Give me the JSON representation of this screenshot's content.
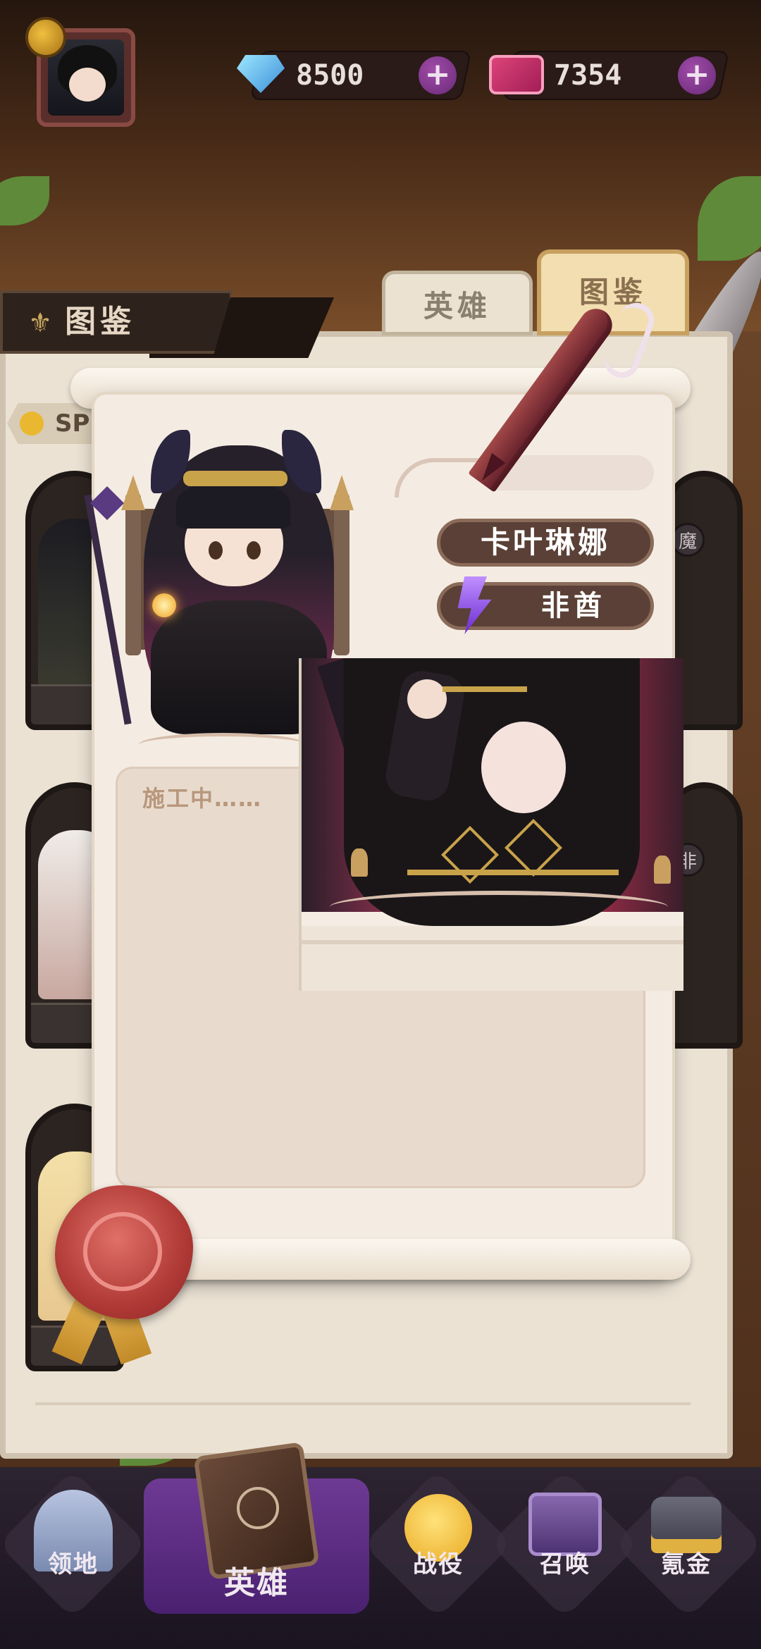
{
  "hud": {
    "gems": "8500",
    "tickets": "7354",
    "plus_symbol": "+"
  },
  "tabs": {
    "hero": "英雄",
    "codex": "图鉴"
  },
  "side_banner": {
    "title": "图鉴"
  },
  "list": {
    "sp_label": "SP",
    "badges": [
      "魔",
      "非"
    ]
  },
  "scroll": {
    "hero_name": "卡叶琳娜",
    "faction": "非酋",
    "description": "施工中……"
  },
  "nav": {
    "items": [
      {
        "label": "领地",
        "icon": "castle-icon"
      },
      {
        "label": "英雄",
        "icon": "spellbook-icon",
        "active": true
      },
      {
        "label": "战役",
        "icon": "chick-knight-icon"
      },
      {
        "label": "召唤",
        "icon": "summon-altar-icon"
      },
      {
        "label": "氪金",
        "icon": "treasure-chest-icon"
      }
    ]
  },
  "colors": {
    "nav_active": "#6e3a94",
    "plate_brown": "#5a4036",
    "plus_purple": "#8a3a98",
    "seal_red": "#b03a36"
  }
}
